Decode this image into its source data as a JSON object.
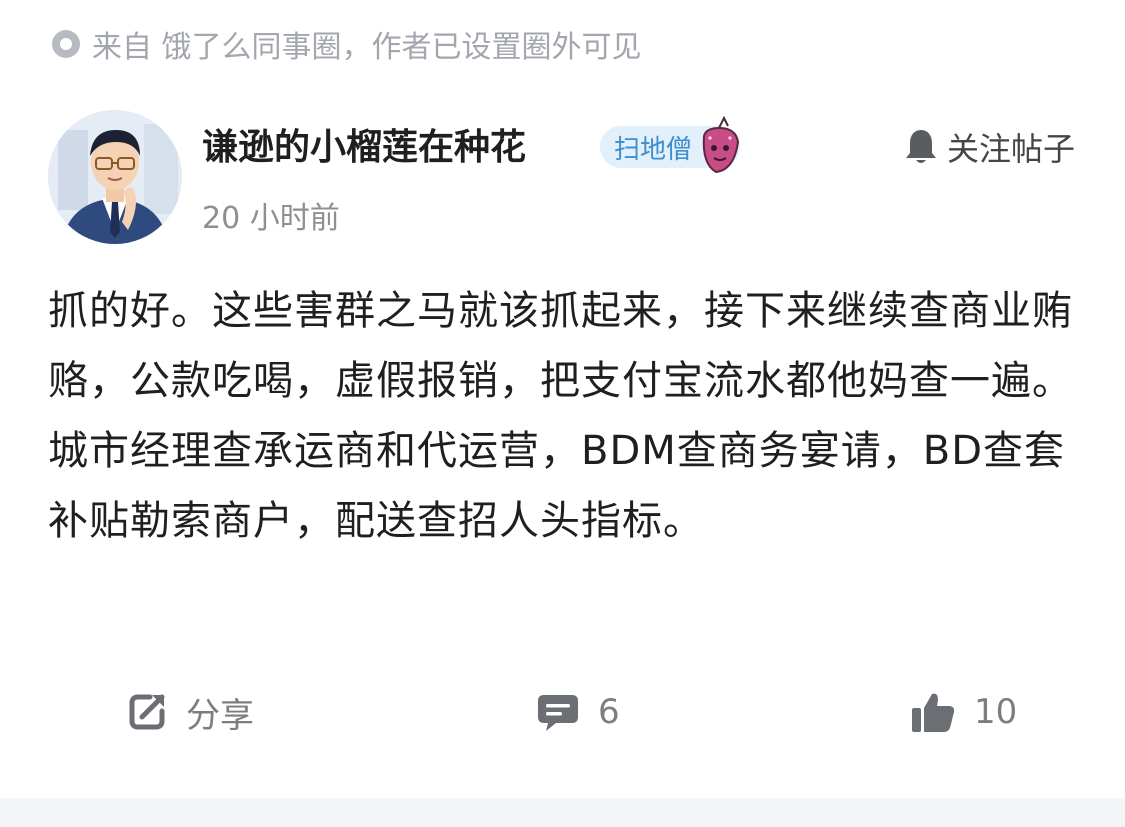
{
  "source": {
    "text": "来自 饿了么同事圈，作者已设置圈外可见"
  },
  "post": {
    "author": "谦逊的小榴莲在种花",
    "badge": "扫地僧",
    "follow_label": "关注帖子",
    "timestamp": "20 小时前",
    "content": "抓的好。这些害群之马就该抓起来，接下来继续查商业贿赂，公款吃喝，虚假报销，把支付宝流水都他妈查一遍。城市经理查承运商和代运营，BDM查商务宴请，BD查套补贴勒索商户，配送查招人头指标。"
  },
  "actions": {
    "share_label": "分享",
    "comment_count": "6",
    "like_count": "10"
  },
  "colors": {
    "badge_bg": "#e1f0fb",
    "badge_text": "#3d8fcf",
    "muted_text": "#a3a7ad",
    "icon_gray": "#6b6e73"
  }
}
